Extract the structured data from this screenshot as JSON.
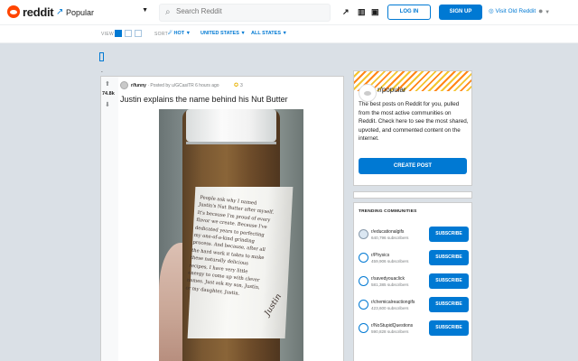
{
  "header": {
    "logo_text": "reddit",
    "feed": "Popular",
    "search_placeholder": "Search Reddit",
    "login": "LOG IN",
    "signup": "SIGN UP",
    "old_reddit": "Visit Old Reddit"
  },
  "sortbar": {
    "view_label": "VIEW",
    "sort_label": "SORT",
    "sort": "HOT",
    "country": "UNITED STATES",
    "region": "ALL STATES"
  },
  "post": {
    "score": "74.8k",
    "subreddit": "r/funny",
    "posted_by": "· Posted by u/GCasiTR 6 hours ago",
    "awards": "3",
    "title": "Justin explains the name behind his Nut Butter",
    "label_text": "People ask why I named Justin's Nut Butter after myself. It's because I'm proud of every flavor we create. Because I've dedicated years to perfecting my one-of-a-kind grinding process. And because, after all the hard work it takes to make these naturally delicious recipes, I have very little energy to come up with clever names. Just ask my son, Justin, or my daughter, Justin.",
    "signature": "Justin"
  },
  "sidebar": {
    "popular": {
      "name": "r/popular",
      "description": "The best posts on Reddit for you, pulled from the most active communities on Reddit. Check here to see the most shared, upvoted, and commented content on the internet.",
      "button": "CREATE POST"
    },
    "trending": {
      "title": "TRENDING COMMUNITIES",
      "button": "SUBSCRIBE",
      "items": [
        {
          "name": "r/educationalgifs",
          "subs": "640,796 subscribers"
        },
        {
          "name": "r/Physics",
          "subs": "459,906 subscribers"
        },
        {
          "name": "r/savedyouaclick",
          "subs": "581,385 subscribers"
        },
        {
          "name": "r/chemicalreactiongifs",
          "subs": "423,600 subscribers"
        },
        {
          "name": "r/NoStupidQuestions",
          "subs": "590,828 subscribers"
        }
      ]
    }
  },
  "colors": {
    "accent": "#0079d3",
    "brand": "#ff4500",
    "background": "#dae0e6"
  },
  "icons": [
    "reddit-logo-icon",
    "trending-icon",
    "chart-icon",
    "tv-icon",
    "chat-icon",
    "user-icon",
    "search-icon",
    "upvote-icon",
    "downvote-icon",
    "award-icon"
  ]
}
